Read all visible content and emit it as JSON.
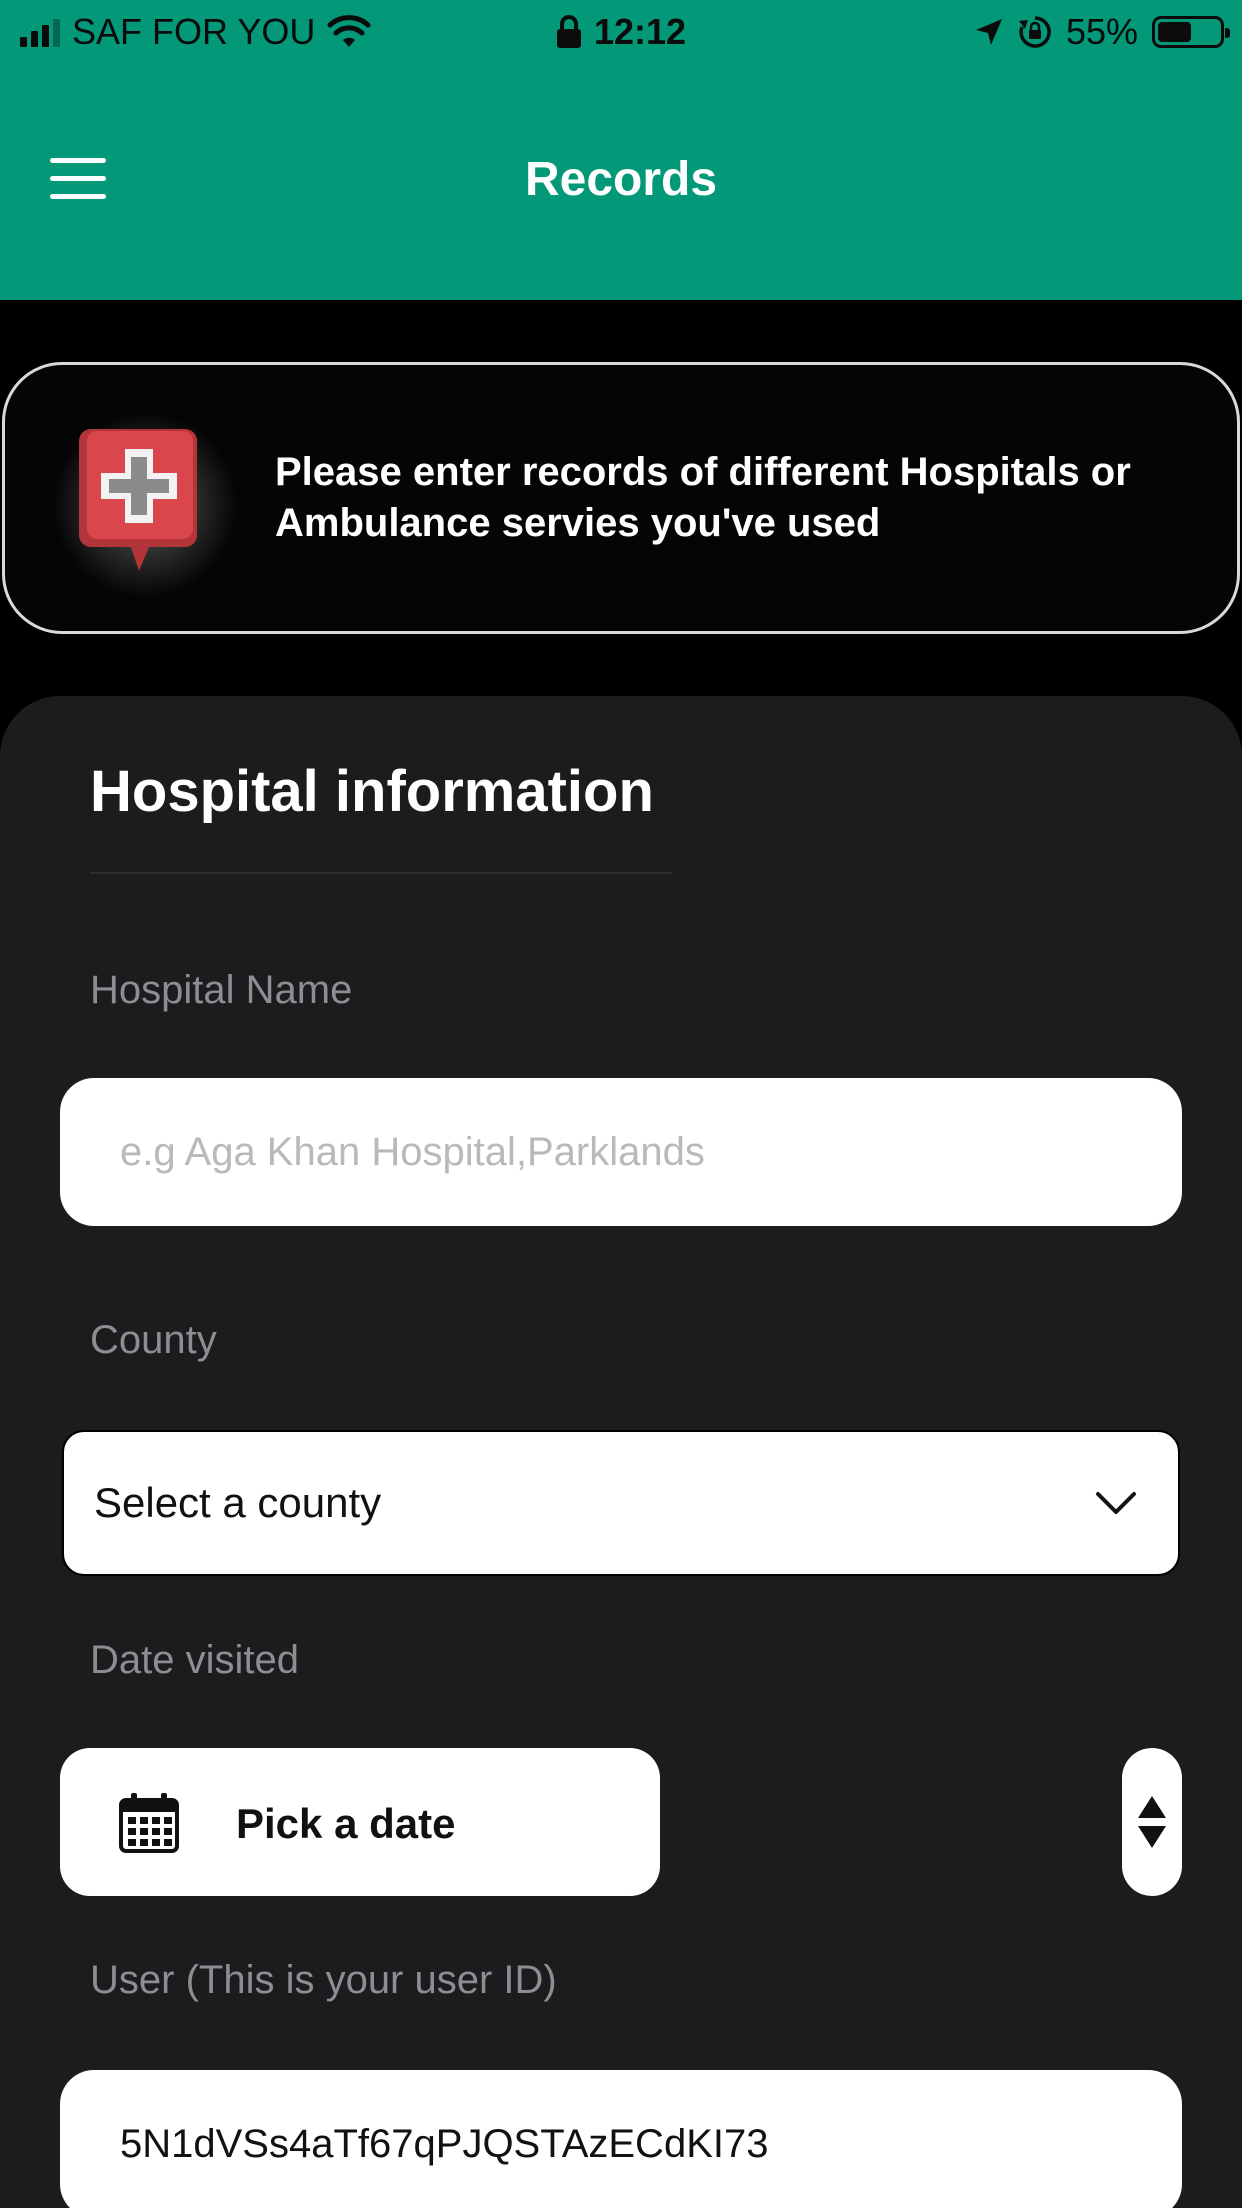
{
  "status_bar": {
    "carrier": "SAF FOR YOU",
    "time": "12:12",
    "battery": "55%",
    "battery_level": 0.55,
    "icons": [
      "signal-icon",
      "wifi-icon",
      "lock-icon",
      "location-icon",
      "rotation-lock-icon",
      "battery-icon"
    ]
  },
  "app_bar": {
    "title": "Records",
    "menu_icon": "hamburger-menu-icon",
    "color": "#029878"
  },
  "banner": {
    "icon": "hospital-cross-icon",
    "text": "Please enter records of different Hospitals or Ambulance servies you've used"
  },
  "form": {
    "title": "Hospital information",
    "hospital_name": {
      "label": "Hospital Name",
      "value": "",
      "placeholder": "e.g Aga Khan Hospital,Parklands"
    },
    "county": {
      "label": "County",
      "selected": "Select a county"
    },
    "date_visited": {
      "label": "Date visited",
      "button_label": "Pick a date"
    },
    "user": {
      "label": "User (This is your user ID)",
      "value": "5N1dVSs4aTf67qPJQSTAzECdKI73"
    }
  }
}
